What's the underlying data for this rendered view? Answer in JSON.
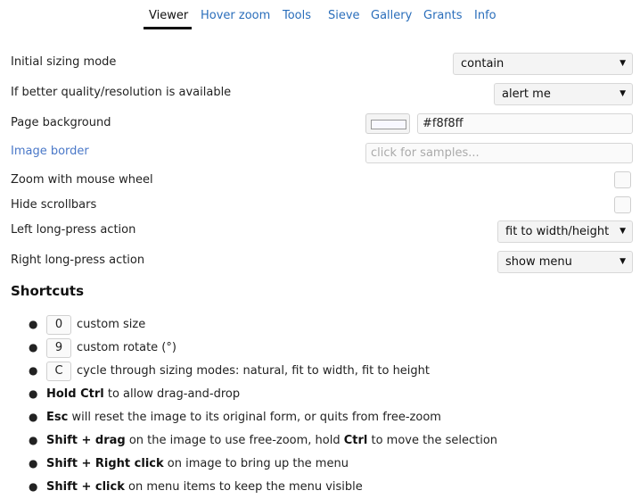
{
  "tabs": [
    {
      "label": "Viewer",
      "active": true
    },
    {
      "label": "Hover zoom"
    },
    {
      "label": "Tools"
    },
    {
      "label": "Sieve"
    },
    {
      "label": "Gallery"
    },
    {
      "label": "Grants"
    },
    {
      "label": "Info"
    }
  ],
  "settings": {
    "initial_sizing": {
      "label": "Initial sizing mode",
      "value": "contain"
    },
    "better_quality": {
      "label": "If better quality/resolution is available",
      "value": "alert me"
    },
    "page_background": {
      "label": "Page background",
      "value": "#f8f8ff",
      "swatch_color": "#f8f8ff"
    },
    "image_border": {
      "label": "Image border",
      "placeholder": "click for samples..."
    },
    "zoom_wheel": {
      "label": "Zoom with mouse wheel",
      "checked": false
    },
    "hide_scrollbars": {
      "label": "Hide scrollbars",
      "checked": false
    },
    "left_long_press": {
      "label": "Left long-press action",
      "value": "fit to width/height"
    },
    "right_long_press": {
      "label": "Right long-press action",
      "value": "show menu"
    }
  },
  "shortcuts": {
    "title": "Shortcuts",
    "items": [
      {
        "key": "0",
        "text": "custom size"
      },
      {
        "key": "9",
        "text": "custom rotate (°)"
      },
      {
        "key": "C",
        "text": "cycle through sizing modes: natural, fit to width, fit to height"
      },
      {
        "bold1": "Hold Ctrl",
        "text1": " to allow drag-and-drop"
      },
      {
        "bold1": "Esc",
        "text1": " will reset the image to its original form, or quits from free-zoom"
      },
      {
        "bold1": "Shift + drag",
        "text1": " on the image to use free-zoom, hold ",
        "bold2": "Ctrl",
        "text2": " to move the selection"
      },
      {
        "bold1": "Shift + Right click",
        "text1": " on image to bring up the menu"
      },
      {
        "bold1": "Shift + click",
        "text1": " on menu items to keep the menu visible"
      }
    ]
  },
  "arrow_glyph": "▼",
  "bullet_glyph": "●"
}
